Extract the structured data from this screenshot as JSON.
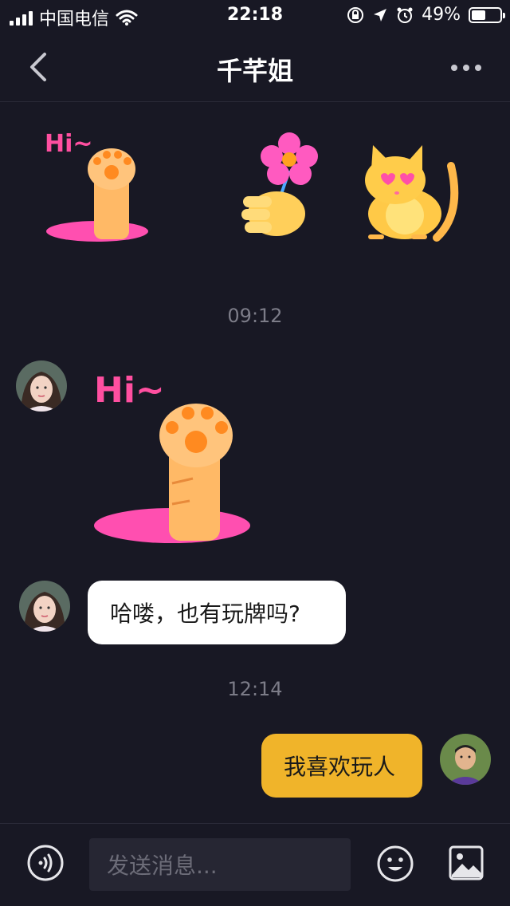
{
  "status_bar": {
    "carrier": "中国电信",
    "time": "22:18",
    "battery": "49%",
    "battery_level": 0.49
  },
  "nav": {
    "title": "千芊姐",
    "back_icon": "chevron-left-icon",
    "more_icon": "more-dots-icon"
  },
  "stickers": [
    {
      "name": "cat-paw-hi-sticker",
      "text": "Hi~"
    },
    {
      "name": "flower-hand-sticker"
    },
    {
      "name": "heart-eyes-cat-sticker"
    }
  ],
  "messages": [
    {
      "type": "timestamp",
      "text": "09:12"
    },
    {
      "type": "sticker",
      "from": "contact",
      "sticker_text": "Hi~"
    },
    {
      "type": "text",
      "from": "contact",
      "text": "哈喽，也有玩牌吗?"
    },
    {
      "type": "timestamp",
      "text": "12:14"
    },
    {
      "type": "text",
      "from": "me",
      "text": "我喜欢玩人"
    }
  ],
  "input_bar": {
    "placeholder": "发送消息...",
    "voice_icon": "voice-icon",
    "emoji_icon": "emoji-icon",
    "image_icon": "image-icon"
  },
  "colors": {
    "background": "#181824",
    "incoming_bubble": "#ffffff",
    "outgoing_bubble": "#f0b42a",
    "timestamp": "#7c7c88"
  }
}
